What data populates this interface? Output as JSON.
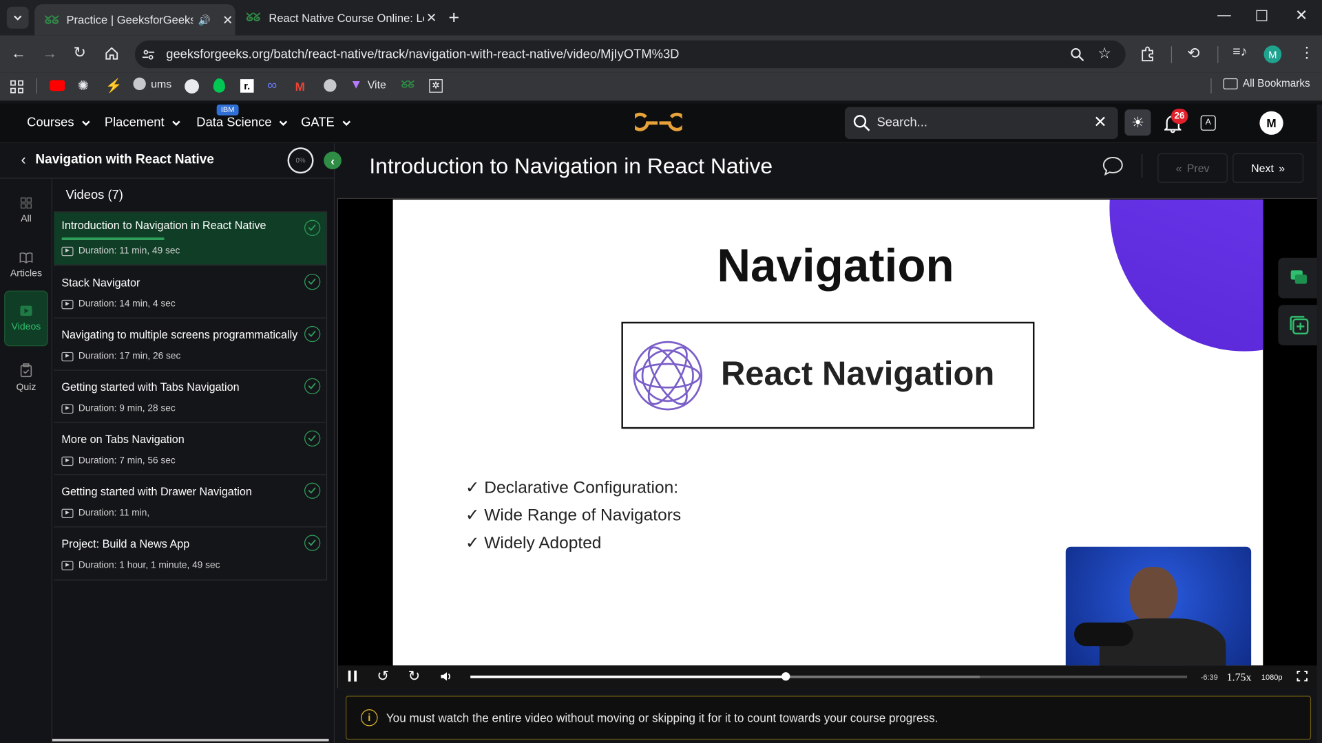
{
  "browser": {
    "tabs": [
      {
        "title": "Practice | GeeksforGeeks | A",
        "active": true
      },
      {
        "title": "React Native Course Online: Lea",
        "active": false
      }
    ],
    "url": "geeksforgeeks.org/batch/react-native/track/navigation-with-react-native/video/MjIyOTM%3D",
    "bookmarks": [
      {
        "label": "",
        "icon": "youtube-icon"
      },
      {
        "label": "",
        "icon": "openai-icon"
      },
      {
        "label": "",
        "icon": "bolt-icon"
      },
      {
        "label": "ums",
        "icon": "globe-icon"
      },
      {
        "label": "",
        "icon": "github-icon"
      },
      {
        "label": "",
        "icon": "leaf-icon"
      },
      {
        "label": "",
        "icon": "notion-icon"
      },
      {
        "label": "",
        "icon": "wave-icon"
      },
      {
        "label": "",
        "icon": "gmail-icon"
      },
      {
        "label": "",
        "icon": "globe-icon"
      },
      {
        "label": "Vite",
        "icon": "vite-icon"
      },
      {
        "label": "",
        "icon": "gfg-icon"
      },
      {
        "label": "",
        "icon": "puzzle-icon"
      }
    ],
    "all_bookmarks": "All Bookmarks",
    "profile_initial": "M"
  },
  "nav": {
    "menus": [
      "Courses",
      "Placement",
      "Data Science",
      "GATE"
    ],
    "ibm_badge": "IBM",
    "search_placeholder": "Search...",
    "notification_count": "26",
    "avatar_initial": "M"
  },
  "sidebar": {
    "course_title": "Navigation with React Native",
    "progress": "0%",
    "rail": [
      {
        "label": "All",
        "icon": "grid-icon"
      },
      {
        "label": "Articles",
        "icon": "book-icon"
      },
      {
        "label": "Videos",
        "icon": "video-icon"
      },
      {
        "label": "Quiz",
        "icon": "clipboard-icon"
      }
    ],
    "videos_heading": "Videos (7)",
    "videos": [
      {
        "title": "Introduction to Navigation in React Native",
        "duration": "Duration: 11 min, 49 sec"
      },
      {
        "title": "Stack Navigator",
        "duration": "Duration: 14 min, 4 sec"
      },
      {
        "title": "Navigating to multiple screens programmatically",
        "duration": "Duration: 17 min, 26 sec"
      },
      {
        "title": "Getting started with Tabs Navigation",
        "duration": "Duration: 9 min, 28 sec"
      },
      {
        "title": "More on Tabs Navigation",
        "duration": "Duration: 7 min, 56 sec"
      },
      {
        "title": "Getting started with Drawer Navigation",
        "duration": "Duration: 11 min,"
      },
      {
        "title": "Project: Build a News App",
        "duration": "Duration: 1 hour, 1 minute, 49 sec"
      }
    ]
  },
  "main": {
    "title": "Introduction to Navigation in React Native",
    "prev_label": "Prev",
    "next_label": "Next",
    "notice": "You must watch the entire video without moving or skipping it for it to count towards your course progress."
  },
  "slide": {
    "heading": "Navigation",
    "logo_text": "React Navigation",
    "bullets": [
      "Declarative Configuration:",
      "Wide Range of Navigators",
      "Widely Adopted"
    ]
  },
  "player": {
    "time_remaining": "-6:39",
    "speed": "1.75x",
    "quality": "1080p",
    "progress": 0.44
  },
  "colors": {
    "accent": "#2f8d46",
    "active_item": "#0f3d25",
    "badge": "#e0202b"
  }
}
